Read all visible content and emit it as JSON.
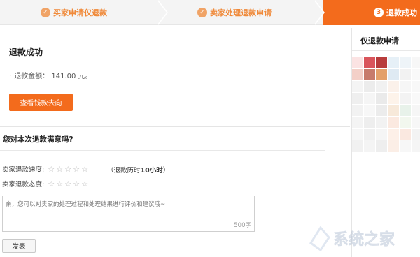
{
  "steps": [
    {
      "num": "✓",
      "label": "买家申请仅退款"
    },
    {
      "num": "✓",
      "label": "卖家处理退款申请"
    },
    {
      "num": "3",
      "label": "退款成功"
    }
  ],
  "main": {
    "success_title": "退款成功",
    "refund_label": "退款金额：",
    "refund_amount": "141.00",
    "refund_unit": "元。",
    "track_button": "查看钱款去向",
    "satisfaction_title": "您对本次退款满意吗?",
    "speed_label": "卖家退款速度:",
    "attitude_label": "卖家退款态度:",
    "hint_prefix": "（退款历时",
    "hint_time": "10小时",
    "hint_suffix": "）",
    "comment_placeholder": "亲，您可以对卖家的处理过程和处理结果进行评价和建议哦~",
    "counter": "500字",
    "submit_button": "发表"
  },
  "side": {
    "title": "仅退款申请"
  },
  "ratings": {
    "speed": 0,
    "attitude": 0,
    "max": 5
  },
  "colors": {
    "accent": "#f36b1c",
    "step_done": "#f08a3a"
  },
  "watermark": "系统之家"
}
